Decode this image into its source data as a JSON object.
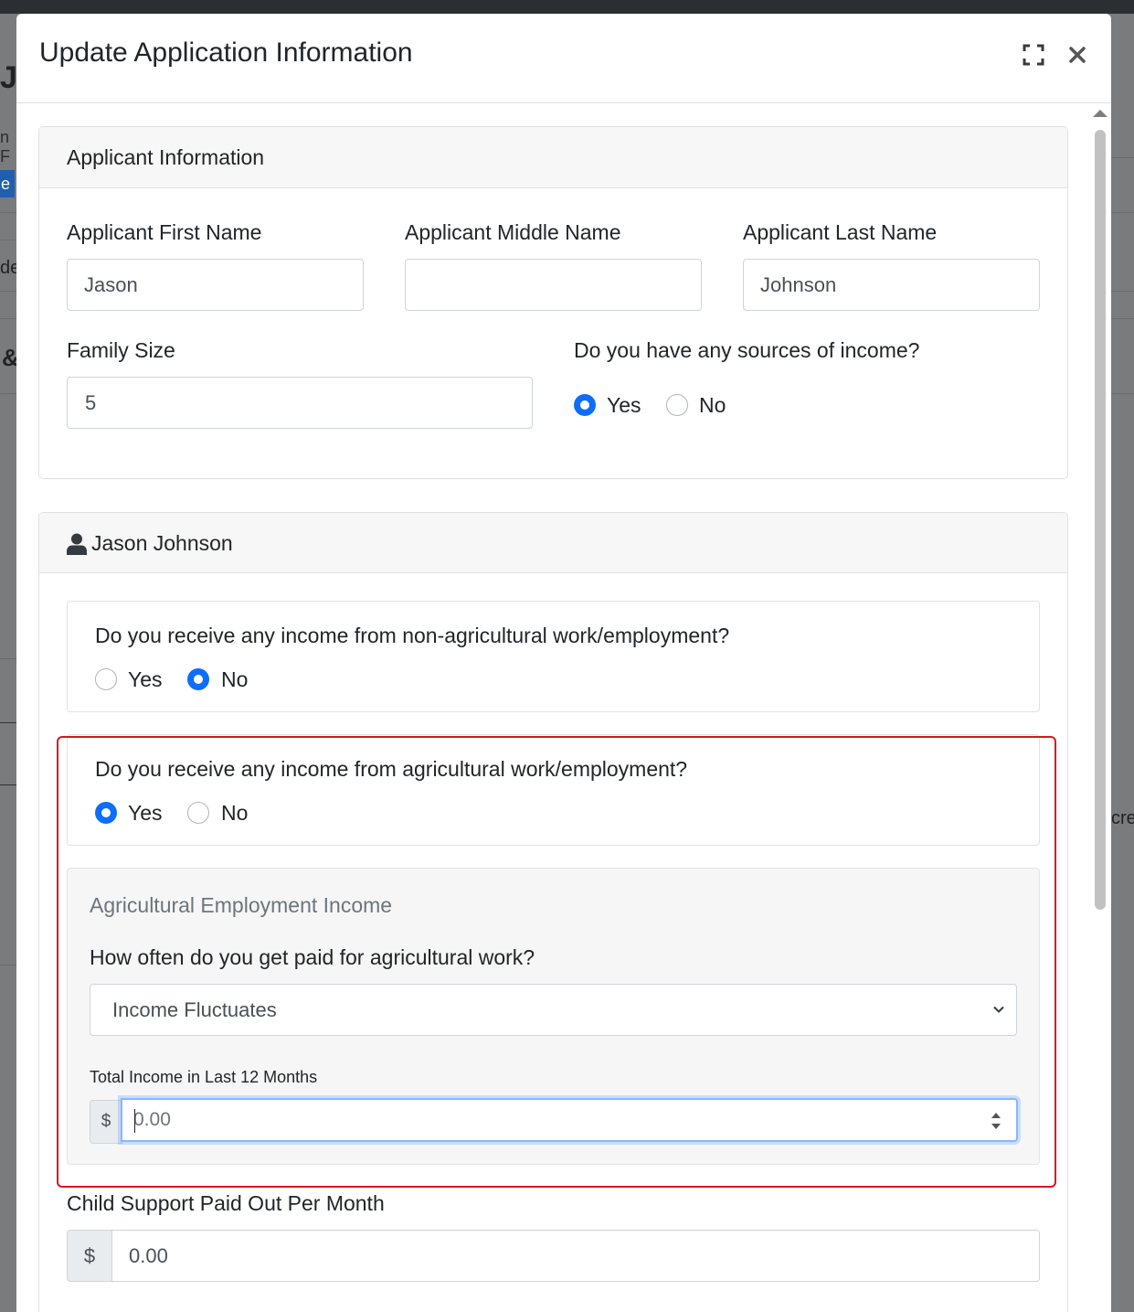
{
  "modal": {
    "title": "Update Application Information"
  },
  "applicant_card": {
    "title": "Applicant Information",
    "first_name_label": "Applicant First Name",
    "first_name_value": "Jason",
    "middle_name_label": "Applicant Middle Name",
    "middle_name_value": "",
    "last_name_label": "Applicant Last Name",
    "last_name_value": "Johnson",
    "family_size_label": "Family Size",
    "family_size_value": "5",
    "income_question": "Do you have any sources of income?",
    "income_options": {
      "yes": "Yes",
      "no": "No",
      "selected": "Yes"
    }
  },
  "person_card": {
    "title": "Jason Johnson",
    "non_ag_question": "Do you receive any income from non-agricultural work/employment?",
    "non_ag_options": {
      "yes": "Yes",
      "no": "No",
      "selected": "No"
    },
    "ag_question": "Do you receive any income from agricultural work/employment?",
    "ag_options": {
      "yes": "Yes",
      "no": "No",
      "selected": "Yes"
    },
    "ag_section": {
      "title": "Agricultural Employment Income",
      "frequency_question": "How often do you get paid for agricultural work?",
      "frequency_value": "Income Fluctuates",
      "total_label": "Total Income in Last 12 Months",
      "currency": "$",
      "total_value": "0.00"
    },
    "child_support_label": "Child Support Paid Out Per Month",
    "child_support_currency": "$",
    "child_support_value": "0.00"
  },
  "icons": {
    "expand": "expand-icon",
    "close": "close-icon",
    "user": "user-icon",
    "chevron": "chevron-down-icon",
    "spinner": "spinner-arrows-icon"
  },
  "colors": {
    "accent": "#0d6efd",
    "highlight_border": "#d7171f",
    "focus_border": "#86b7fe"
  }
}
